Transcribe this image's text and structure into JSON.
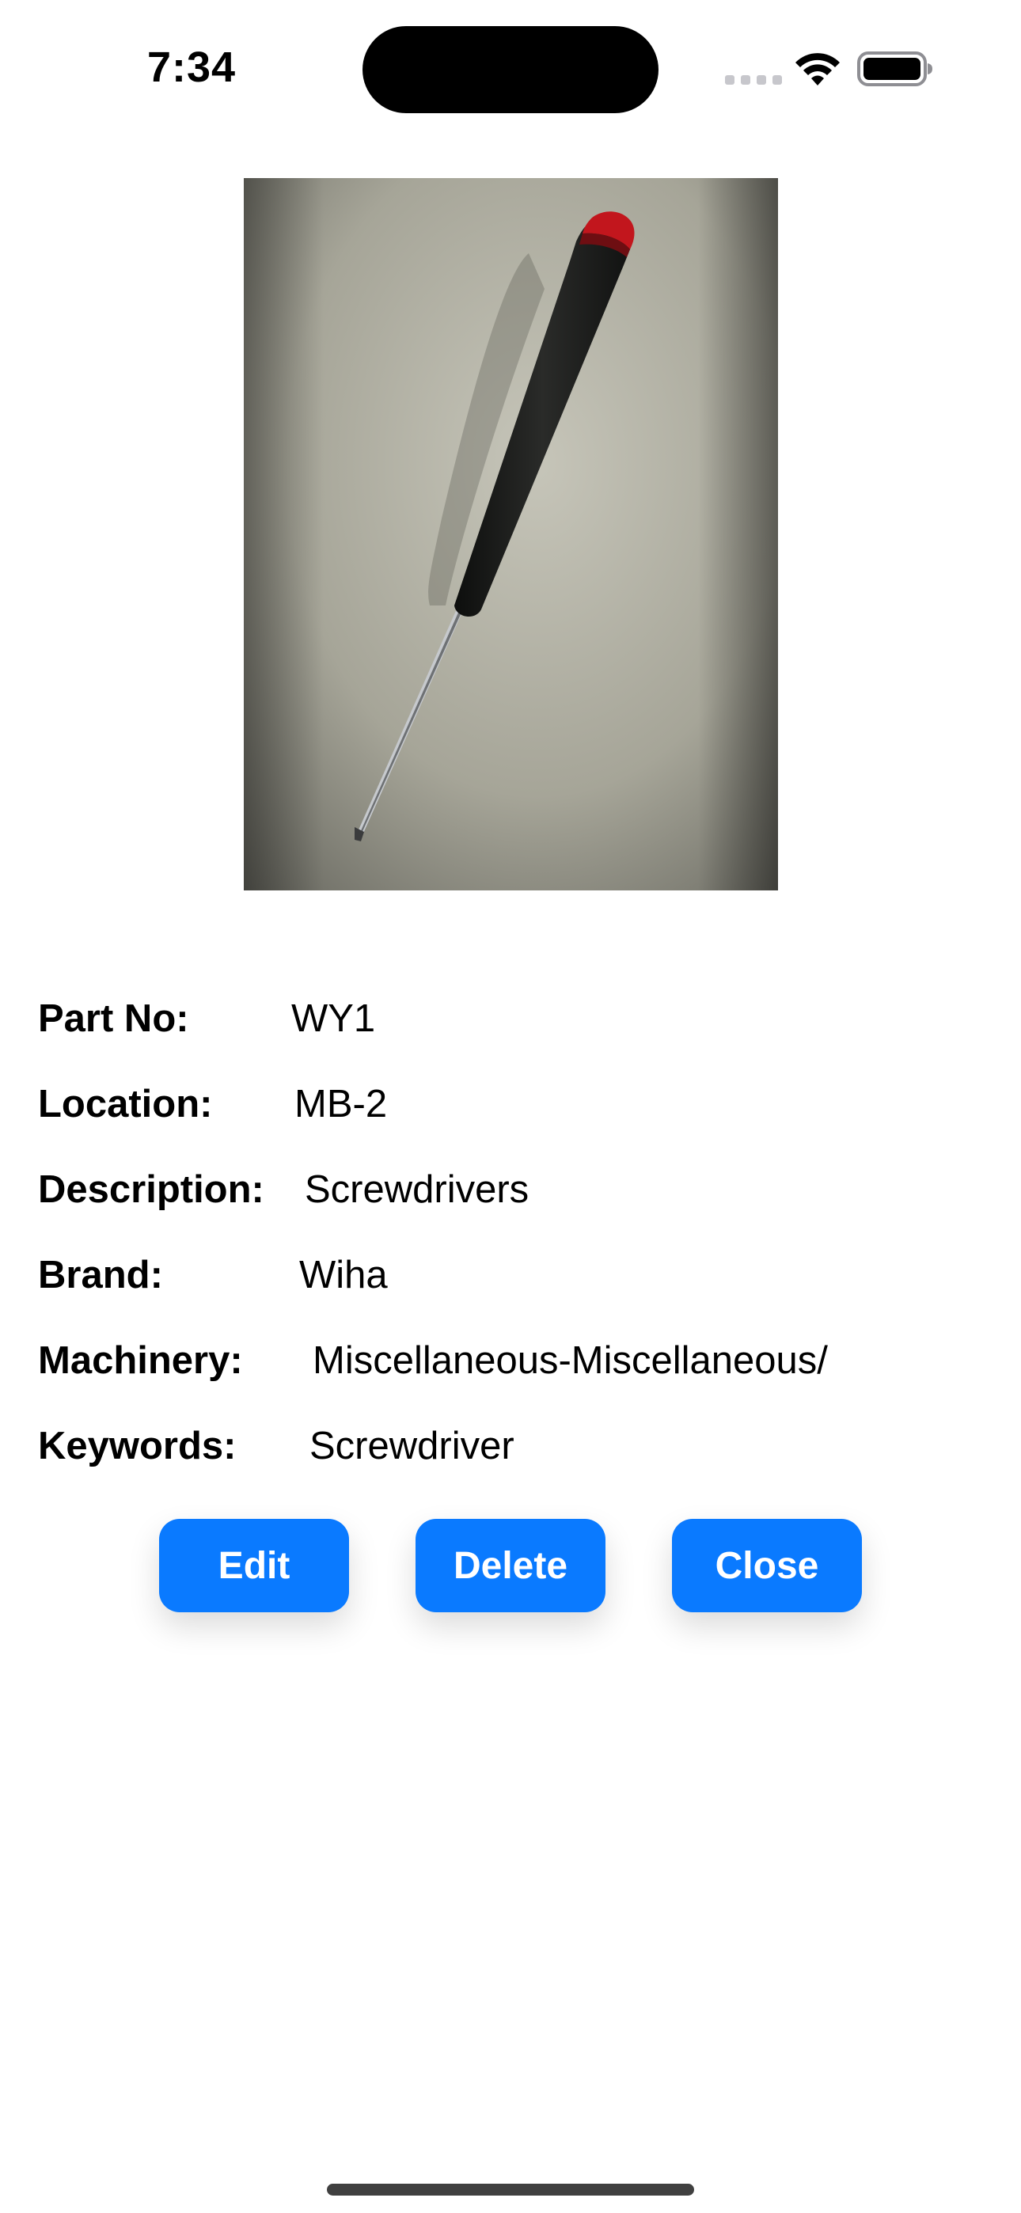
{
  "status_bar": {
    "time": "7:34",
    "icons": [
      "cellular-signal-icon",
      "wifi-icon",
      "battery-icon"
    ]
  },
  "photo": {
    "subject": "screwdriver-photo",
    "colors": {
      "background": "#a9a89c",
      "handle": "#1b1c1a",
      "handle_cap": "#c2161d",
      "shaft": "#b9bcc0"
    }
  },
  "details": {
    "part_no": {
      "label": "Part No:",
      "value": "WY1"
    },
    "location": {
      "label": "Location:",
      "value": "MB-2"
    },
    "description": {
      "label": "Description:",
      "value": "Screwdrivers"
    },
    "brand": {
      "label": "Brand:",
      "value": "Wiha"
    },
    "machinery": {
      "label": "Machinery:",
      "value": "Miscellaneous-Miscellaneous/"
    },
    "keywords": {
      "label": "Keywords:",
      "value": "Screwdriver"
    }
  },
  "actions": {
    "edit_label": "Edit",
    "delete_label": "Delete",
    "close_label": "Close"
  },
  "colors": {
    "accent": "#0a7aff",
    "button_text": "#ffffff"
  }
}
